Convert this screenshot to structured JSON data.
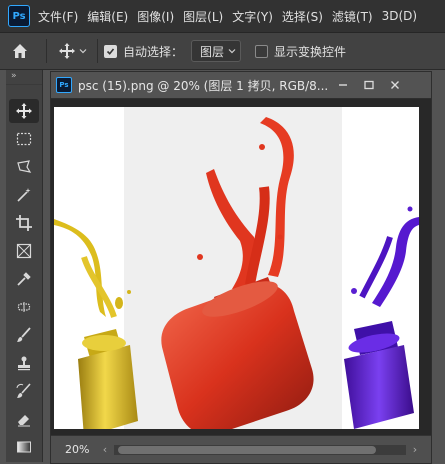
{
  "app": {
    "logo": "Ps"
  },
  "menu": [
    "文件(F)",
    "编辑(E)",
    "图像(I)",
    "图层(L)",
    "文字(Y)",
    "选择(S)",
    "滤镜(T)",
    "3D(D)"
  ],
  "options": {
    "auto_select_label": "自动选择：",
    "auto_select_checked": true,
    "target_value": "图层",
    "transform_controls_label": "显示变换控件",
    "transform_controls_checked": false
  },
  "toolbar": {
    "grip": "»",
    "tools": [
      "move-icon",
      "rect-marquee-icon",
      "lasso-icon",
      "magic-wand-icon",
      "crop-icon",
      "frame-icon",
      "eyedropper-icon",
      "healing-icon",
      "brush-icon",
      "stamp-icon",
      "history-brush-icon",
      "eraser-icon",
      "gradient-icon"
    ]
  },
  "document": {
    "tab_logo": "Ps",
    "title": "psc (15).png @ 20% (图层 1 拷贝, RGB/8...",
    "zoom": "20%"
  },
  "colors": {
    "accent": "#31a8ff",
    "yellow_paint": "#e0c22a",
    "red_paint": "#d93a25",
    "purple_paint": "#5a1fd1"
  }
}
